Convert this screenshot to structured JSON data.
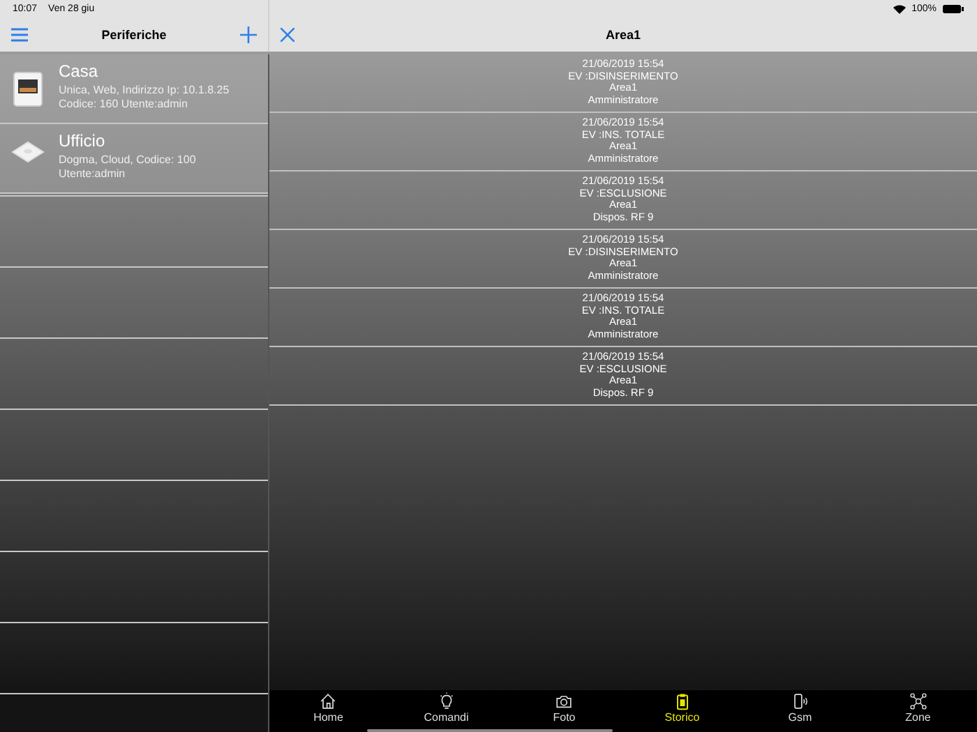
{
  "status_bar": {
    "time": "10:07",
    "date": "Ven 28 giu",
    "battery": "100%"
  },
  "sidebar": {
    "title": "Periferiche",
    "devices": [
      {
        "kind": "panel",
        "name": "Casa",
        "details": "Unica, Web, Indirizzo Ip: 10.1.8.25\nCodice: 160 Utente:admin"
      },
      {
        "kind": "sensor",
        "name": "Ufficio",
        "details": "Dogma, Cloud, Codice: 100\nUtente:admin"
      }
    ]
  },
  "detail": {
    "title": "Area1",
    "events": [
      {
        "time": "21/06/2019 15:54",
        "event": "EV :DISINSERIMENTO",
        "area": "Area1",
        "user": "Amministratore"
      },
      {
        "time": "21/06/2019 15:54",
        "event": "EV :INS. TOTALE",
        "area": "Area1",
        "user": "Amministratore"
      },
      {
        "time": "21/06/2019 15:54",
        "event": "EV :ESCLUSIONE",
        "area": "Area1",
        "user": "Dispos. RF 9"
      },
      {
        "time": "21/06/2019 15:54",
        "event": "EV :DISINSERIMENTO",
        "area": "Area1",
        "user": "Amministratore"
      },
      {
        "time": "21/06/2019 15:54",
        "event": "EV :INS. TOTALE",
        "area": "Area1",
        "user": "Amministratore"
      },
      {
        "time": "21/06/2019 15:54",
        "event": "EV :ESCLUSIONE",
        "area": "Area1",
        "user": "Dispos. RF 9"
      }
    ]
  },
  "tab_bar": [
    {
      "kind": "home",
      "label": "Home",
      "selected": false
    },
    {
      "kind": "bulb",
      "label": "Comandi",
      "selected": false
    },
    {
      "kind": "camera",
      "label": "Foto",
      "selected": false
    },
    {
      "kind": "clipboard",
      "label": "Storico",
      "selected": true
    },
    {
      "kind": "phone",
      "label": "Gsm",
      "selected": false
    },
    {
      "kind": "network",
      "label": "Zone",
      "selected": false
    }
  ]
}
